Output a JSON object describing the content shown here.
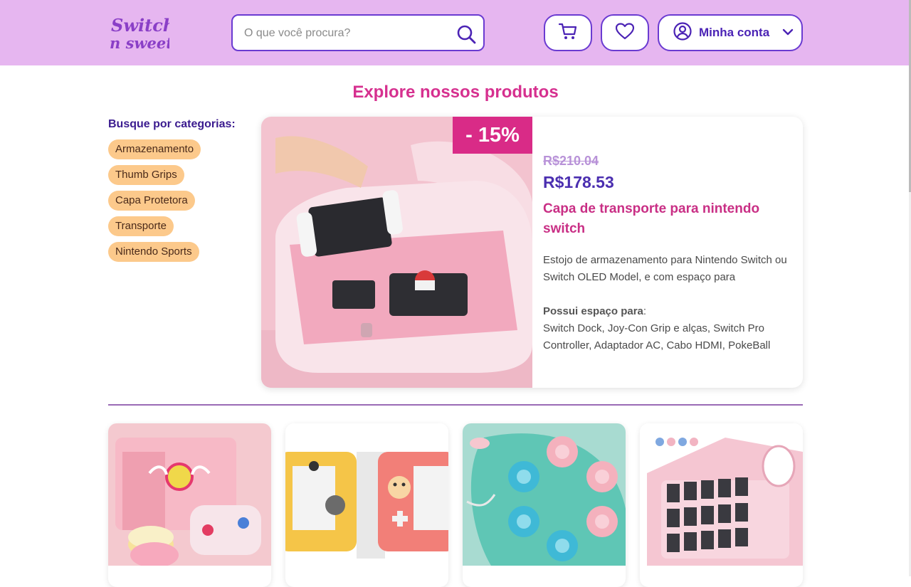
{
  "header": {
    "logo_text": "Switch n sweet",
    "search": {
      "placeholder": "O que você procura?",
      "value": ""
    },
    "account_label": "Minha conta"
  },
  "main": {
    "section_title": "Explore nossos produtos",
    "categories_title": "Busque por categorias:",
    "categories": [
      "Armazenamento",
      "Thumb Grips",
      "Capa Protetora",
      "Transporte",
      "Nintendo Sports"
    ]
  },
  "featured": {
    "discount_badge": "- 15%",
    "old_price": "R$210.04",
    "new_price": "R$178.53",
    "name": "Capa de transporte para nintendo switch",
    "description": "Estojo de armazenamento para Nintendo Switch ou Switch OLED Model, e com espaço para acessórios.",
    "has_space_label": "Possui espaço para",
    "has_space_colon": ":",
    "has_space_items": "Switch Dock, Joy-Con Grip e alças, Switch Pro Controller, Adaptador AC, Cabo HDMI, PokeBall Plus"
  },
  "colors": {
    "header_bg": "#e6b6f0",
    "accent_purple": "#4b23b5",
    "accent_pink": "#d6308f",
    "chip_bg": "#fcc98b"
  },
  "icons": [
    "search-icon",
    "cart-icon",
    "heart-icon",
    "user-circle-icon",
    "chevron-down-icon"
  ]
}
